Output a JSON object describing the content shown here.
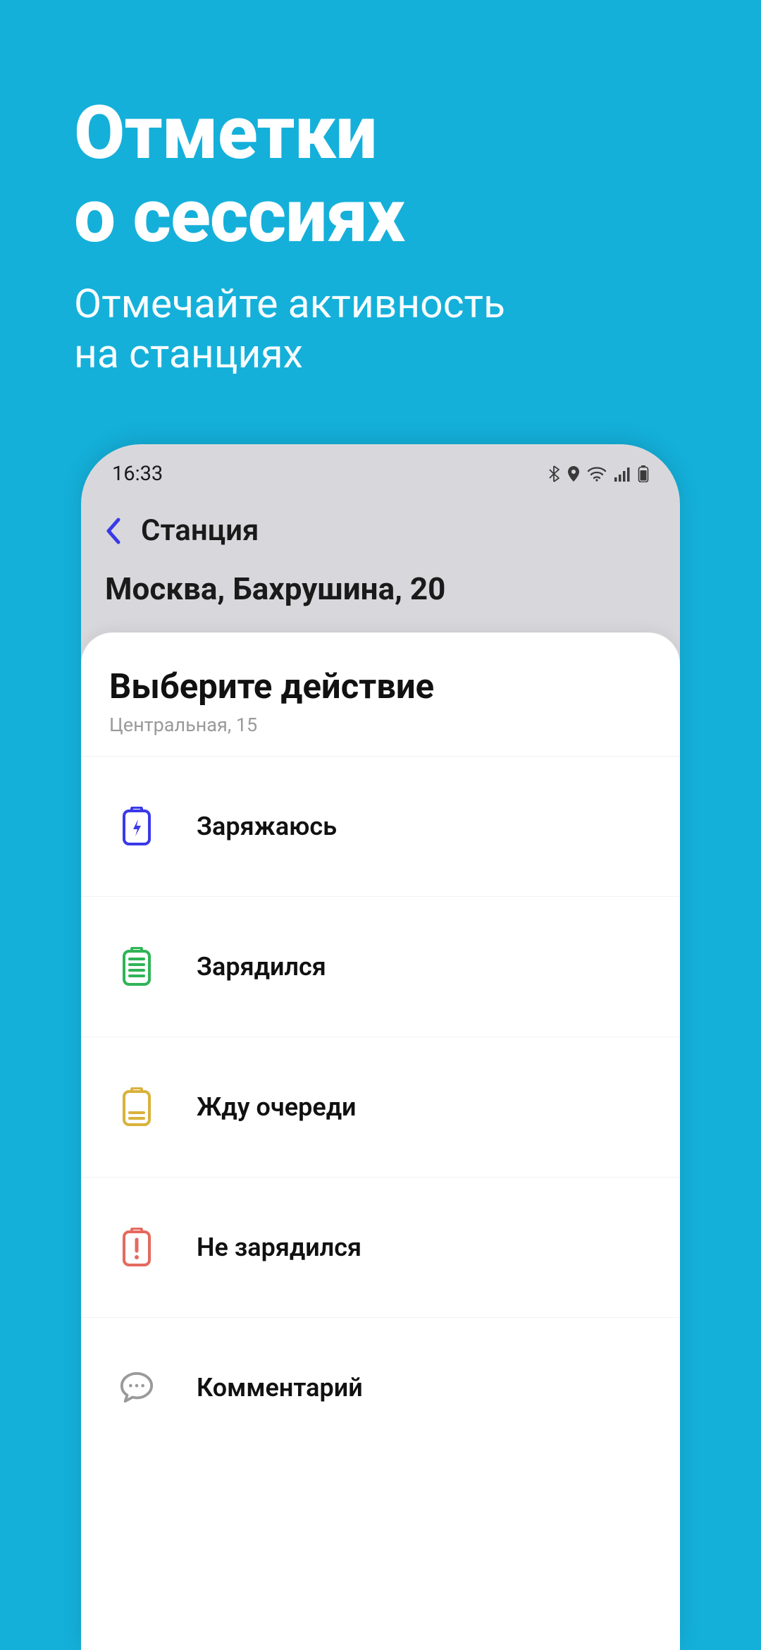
{
  "promo": {
    "title_line1": "Отметки",
    "title_line2": "о  сессиях",
    "subtitle_line1": "Отмечайте активность",
    "subtitle_line2": "на станциях"
  },
  "status_bar": {
    "time": "16:33"
  },
  "header": {
    "title": "Станция"
  },
  "station": {
    "address": "Москва, Бахрушина, 20"
  },
  "sheet": {
    "title": "Выберите действие",
    "subtitle": "Центральная, 15",
    "actions": [
      {
        "label": "Заряжаюсь",
        "icon": "battery-charging",
        "color": "#3a39e8"
      },
      {
        "label": "Зарядился",
        "icon": "battery-full",
        "color": "#2fb457"
      },
      {
        "label": "Жду очереди",
        "icon": "battery-low",
        "color": "#d9b23b"
      },
      {
        "label": "Не зарядился",
        "icon": "battery-alert",
        "color": "#e46a5e"
      },
      {
        "label": "Комментарий",
        "icon": "comment",
        "color": "#9a9a9a"
      }
    ]
  }
}
